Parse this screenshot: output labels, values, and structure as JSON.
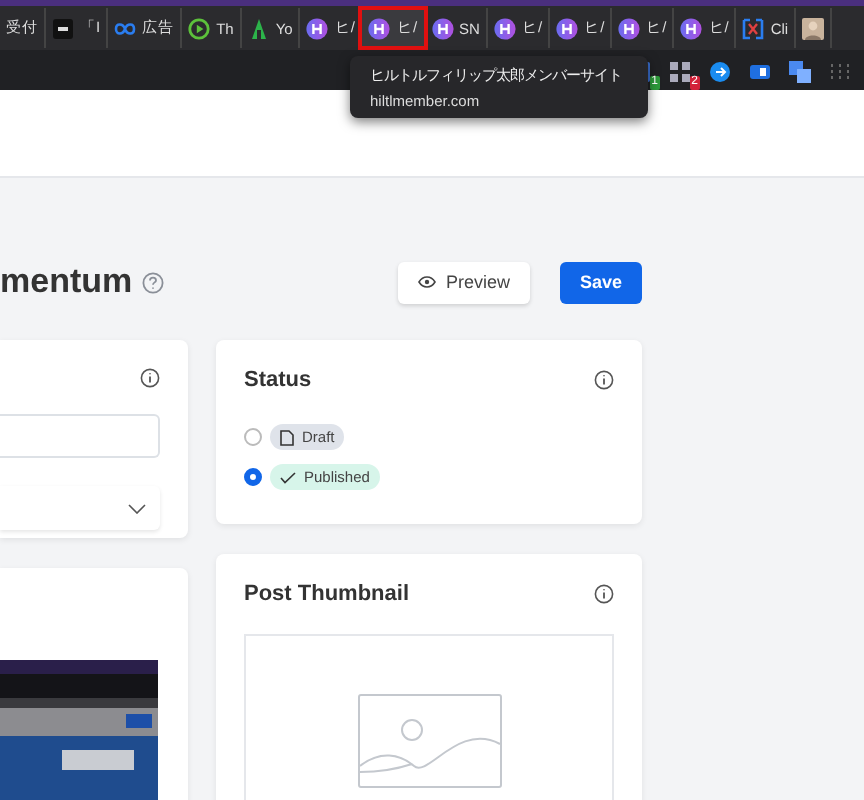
{
  "bookmarks": [
    {
      "label": "受付",
      "kind": "none",
      "highlighted": false
    },
    {
      "label": "「I",
      "kind": "si",
      "highlighted": false
    },
    {
      "label": "広告",
      "kind": "meta",
      "highlighted": false
    },
    {
      "label": "Th",
      "kind": "play",
      "highlighted": false
    },
    {
      "label": "Yo",
      "kind": "a",
      "highlighted": false
    },
    {
      "label": "ヒ/",
      "kind": "h",
      "highlighted": false
    },
    {
      "label": "ヒ/",
      "kind": "h",
      "highlighted": true
    },
    {
      "label": "SN",
      "kind": "h",
      "highlighted": false
    },
    {
      "label": "ヒ/",
      "kind": "h",
      "highlighted": false
    },
    {
      "label": "ヒ/",
      "kind": "h",
      "highlighted": false
    },
    {
      "label": "ヒ/",
      "kind": "h",
      "highlighted": false
    },
    {
      "label": "ヒ/",
      "kind": "h",
      "highlighted": false
    },
    {
      "label": "Cli",
      "kind": "x",
      "highlighted": false
    },
    {
      "kind": "avatar",
      "highlighted": false
    }
  ],
  "tooltip": {
    "title": "ヒルトルフィリップ太郎メンバーサイト",
    "url": "hiltlmember.com"
  },
  "extensions": [
    {
      "kind": "box",
      "badge": "1"
    },
    {
      "kind": "grid",
      "badge": "2"
    },
    {
      "kind": "arrow"
    },
    {
      "kind": "panel"
    },
    {
      "kind": "translate"
    },
    {
      "kind": "dots"
    }
  ],
  "page": {
    "title": "mentum",
    "preview_label": "Preview",
    "save_label": "Save"
  },
  "status": {
    "title": "Status",
    "options": [
      {
        "label": "Draft",
        "kind": "draft",
        "selected": false
      },
      {
        "label": "Published",
        "kind": "published",
        "selected": true
      }
    ]
  },
  "thumbnail": {
    "title": "Post Thumbnail"
  }
}
